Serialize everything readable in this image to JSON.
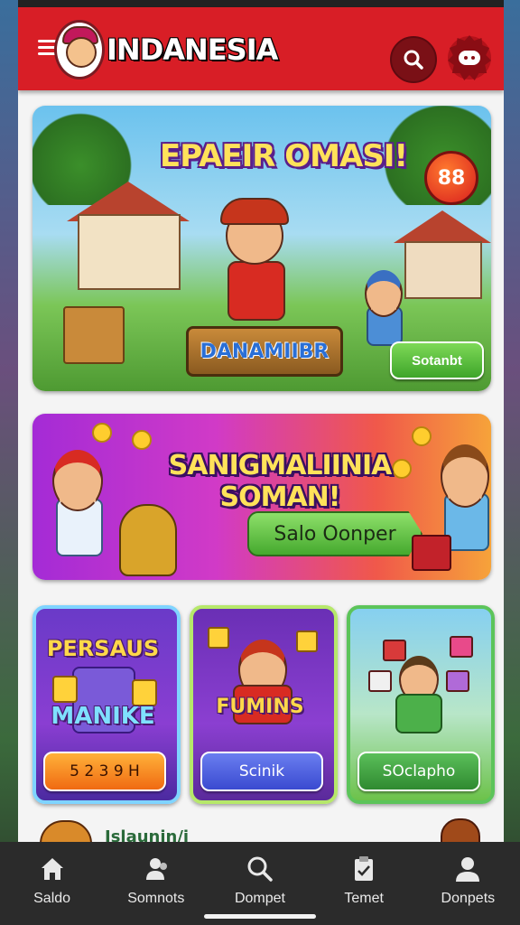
{
  "header": {
    "brand": "INDANESIA",
    "search_icon": "search-icon",
    "chat_icon": "chat-icon"
  },
  "hero": {
    "title": "EPAEIR OMASI!",
    "badge": "88",
    "sign": "DANAMIIBR",
    "button": "Sotanbt"
  },
  "promo": {
    "title": "SANIGMALIINIA SOMAN!",
    "button": "Salo Oonper"
  },
  "tiles": [
    {
      "title_line1": "PERSAUS",
      "title_line2": "MANIKE",
      "button": "5 2 3 9 H"
    },
    {
      "title_line1": "FUMINS",
      "button": "Scinik"
    },
    {
      "button": "SOclapho"
    }
  ],
  "peek": {
    "text": "Islaunin/i"
  },
  "nav": [
    {
      "label": "Saldo",
      "icon": "home-icon"
    },
    {
      "label": "Somnots",
      "icon": "people-icon"
    },
    {
      "label": "Dompet",
      "icon": "search-icon"
    },
    {
      "label": "Temet",
      "icon": "clipboard-icon"
    },
    {
      "label": "Donpets",
      "icon": "profile-icon"
    }
  ]
}
